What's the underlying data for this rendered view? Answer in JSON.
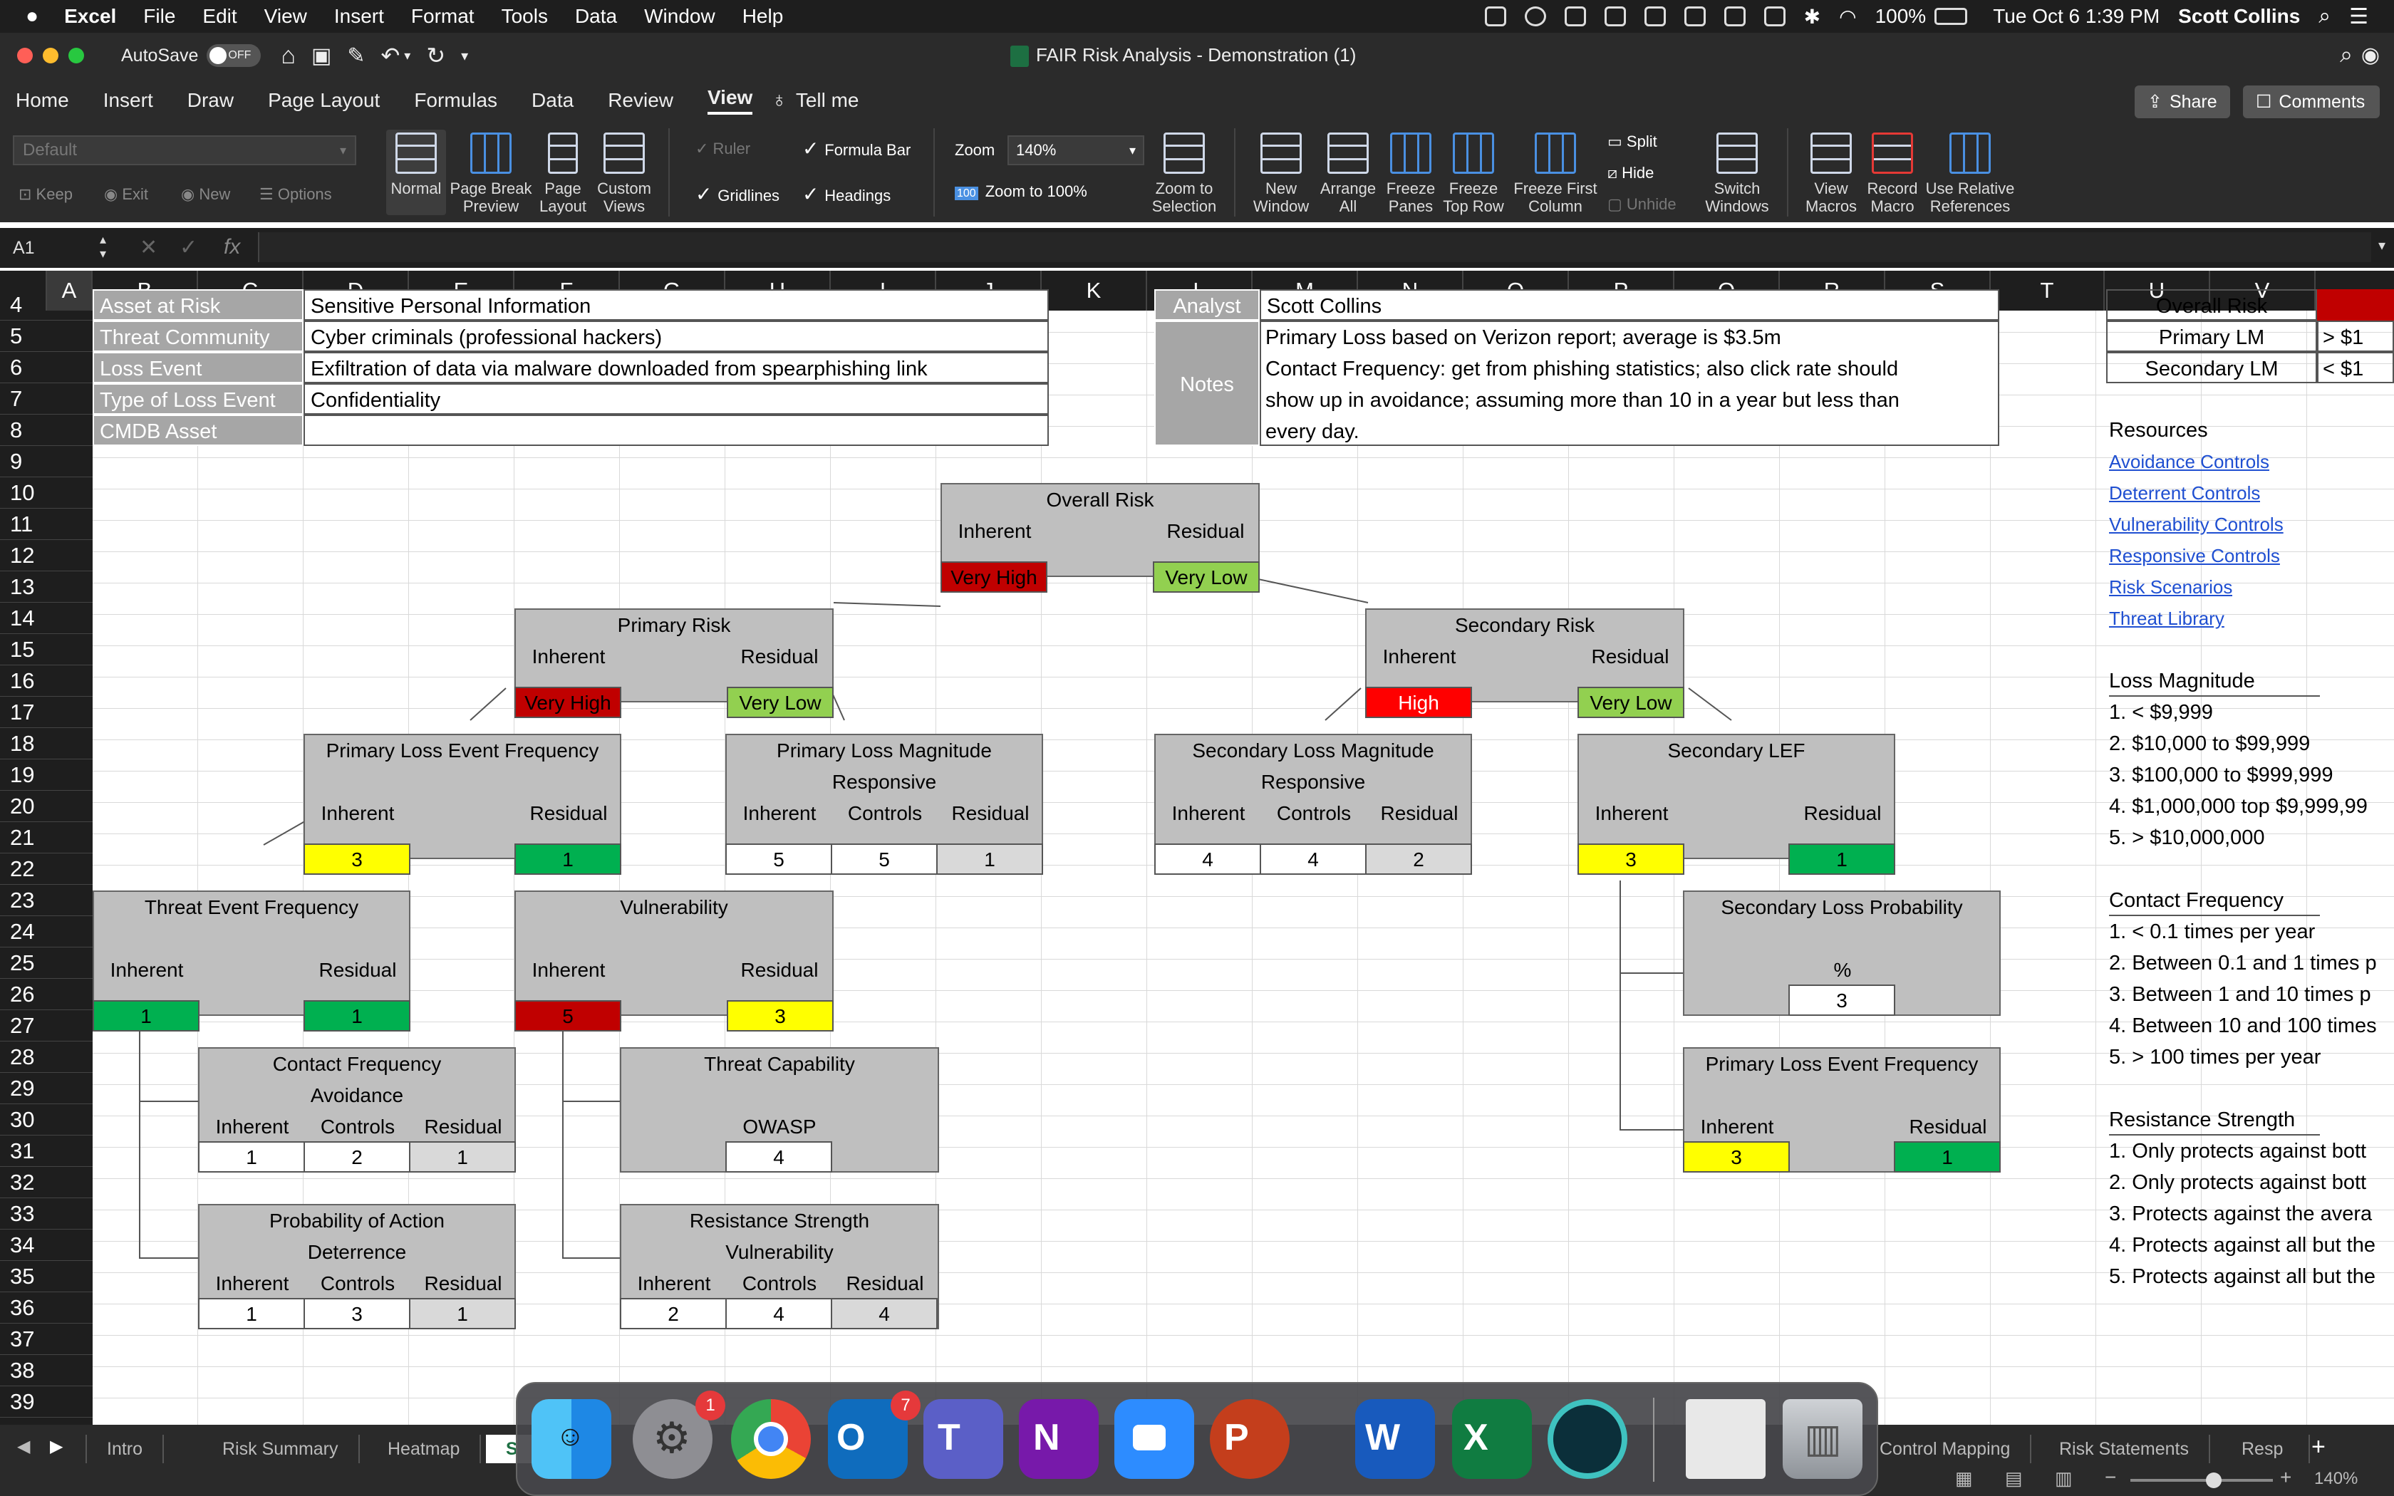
{
  "menubar": {
    "app": "Excel",
    "items": [
      "File",
      "Edit",
      "View",
      "Insert",
      "Format",
      "Tools",
      "Data",
      "Window",
      "Help"
    ],
    "battery": "100%",
    "datetime": "Tue Oct 6  1:39 PM",
    "user": "Scott Collins"
  },
  "titlebar": {
    "autosave_label": "AutoSave",
    "autosave_state": "OFF",
    "doc_title": "FAIR Risk Analysis - Demonstration (1)"
  },
  "ribbon_tabs": [
    "Home",
    "Insert",
    "Draw",
    "Page Layout",
    "Formulas",
    "Data",
    "Review",
    "View"
  ],
  "ribbon_active_tab": "View",
  "tell_me": "Tell me",
  "share_label": "Share",
  "comments_label": "Comments",
  "ribbon": {
    "sheet_view_select": "Default",
    "keep": "Keep",
    "exit": "Exit",
    "new": "New",
    "options": "Options",
    "normal": "Normal",
    "page_break_preview": [
      "Page Break",
      "Preview"
    ],
    "page_layout": [
      "Page",
      "Layout"
    ],
    "custom_views": [
      "Custom",
      "Views"
    ],
    "ruler": "Ruler",
    "formula_bar": "Formula Bar",
    "gridlines": "Gridlines",
    "headings": "Headings",
    "zoom_label": "Zoom",
    "zoom_value": "140%",
    "zoom_100_icon": "100",
    "zoom_to_100": "Zoom to 100%",
    "zoom_to_selection": [
      "Zoom to",
      "Selection"
    ],
    "new_window": [
      "New",
      "Window"
    ],
    "arrange_all": [
      "Arrange",
      "All"
    ],
    "freeze_panes": [
      "Freeze",
      "Panes"
    ],
    "freeze_top_row": [
      "Freeze",
      "Top Row"
    ],
    "freeze_first_column": [
      "Freeze First",
      "Column"
    ],
    "split": "Split",
    "hide": "Hide",
    "unhide": "Unhide",
    "switch_windows": [
      "Switch",
      "Windows"
    ],
    "view_macros": [
      "View",
      "Macros"
    ],
    "record_macro": [
      "Record",
      "Macro"
    ],
    "use_relative_references": [
      "Use Relative",
      "References"
    ]
  },
  "formula_bar": {
    "name_box": "A1",
    "fx": "fx",
    "content": ""
  },
  "columns": [
    "A",
    "B",
    "C",
    "D",
    "E",
    "F",
    "G",
    "H",
    "I",
    "J",
    "K",
    "L",
    "M",
    "N",
    "O",
    "P",
    "Q",
    "R",
    "S",
    "T",
    "U",
    "V"
  ],
  "rows": [
    "4",
    "5",
    "6",
    "7",
    "8",
    "9",
    "10",
    "11",
    "12",
    "13",
    "14",
    "15",
    "16",
    "17",
    "18",
    "19",
    "20",
    "21",
    "22",
    "23",
    "24",
    "25",
    "26",
    "27",
    "28",
    "29",
    "30",
    "31",
    "32",
    "33",
    "34",
    "35",
    "36",
    "37",
    "38",
    "39"
  ],
  "info_labels": [
    {
      "label": "Asset at Risk",
      "value": "Sensitive Personal Information"
    },
    {
      "label": "Threat Community",
      "value": "Cyber criminals (professional hackers)"
    },
    {
      "label": "Loss Event",
      "value": "Exfiltration of data via malware downloaded from spearphishing link"
    },
    {
      "label": "Type of Loss Event",
      "value": "Confidentiality"
    },
    {
      "label": "CMDB Asset",
      "value": ""
    }
  ],
  "analyst": {
    "label": "Analyst",
    "value": "Scott Collins"
  },
  "notes": {
    "label": "Notes",
    "lines": [
      "Primary Loss based on Verizon report; average is $3.5m",
      "Contact Frequency: get from phishing statistics; also click rate should",
      "show up in avoidance; assuming more than 10 in a year but less than",
      "every day."
    ]
  },
  "common": {
    "inherent": "Inherent",
    "residual": "Residual",
    "controls": "Controls"
  },
  "overall_risk": {
    "title": "Overall Risk",
    "inherent": "Very High",
    "residual": "Very Low"
  },
  "primary_risk": {
    "title": "Primary Risk",
    "inherent": "Very High",
    "residual": "Very Low"
  },
  "secondary_risk": {
    "title": "Secondary Risk",
    "inherent": "High",
    "residual": "Very Low"
  },
  "plef": {
    "title": "Primary Loss Event Frequency",
    "inherent": "3",
    "residual": "1"
  },
  "plm": {
    "title": "Primary Loss Magnitude",
    "subtitle": "Responsive",
    "inherent": "5",
    "controls": "5",
    "residual": "1"
  },
  "slm": {
    "title": "Secondary Loss Magnitude",
    "subtitle": "Responsive",
    "inherent": "4",
    "controls": "4",
    "residual": "2"
  },
  "slef": {
    "title": "Secondary LEF",
    "inherent": "3",
    "residual": "1"
  },
  "tef": {
    "title": "Threat Event Frequency",
    "inherent": "1",
    "residual": "1"
  },
  "vuln": {
    "title": "Vulnerability",
    "inherent": "5",
    "residual": "3"
  },
  "slp": {
    "title": "Secondary Loss Probability",
    "unit": "%",
    "value": "3"
  },
  "plef2": {
    "title": "Primary Loss Event Frequency",
    "inherent": "3",
    "residual": "1"
  },
  "cf": {
    "title": "Contact Frequency",
    "subtitle": "Avoidance",
    "inherent": "1",
    "controls": "2",
    "residual": "1"
  },
  "tc": {
    "title": "Threat Capability",
    "subtitle": "OWASP",
    "value": "4"
  },
  "poa": {
    "title": "Probability of Action",
    "subtitle": "Deterrence",
    "inherent": "1",
    "controls": "3",
    "residual": "1"
  },
  "rs": {
    "title": "Resistance Strength",
    "subtitle": "Vulnerability",
    "inherent": "2",
    "controls": "4",
    "residual": "4"
  },
  "right_panel": {
    "header_partial": "Overall Risk",
    "primary_lm": "Primary LM",
    "primary_lm_val": "> $1",
    "secondary_lm": "Secondary LM",
    "secondary_lm_val": "< $1",
    "resources_title": "Resources",
    "resources": [
      "Avoidance Controls",
      "Deterrent Controls",
      "Vulnerability Controls",
      "Responsive Controls",
      "Risk Scenarios",
      "Threat Library"
    ],
    "loss_magnitude_title": "Loss Magnitude",
    "loss_magnitude": [
      "1. < $9,999",
      "2. $10,000 to $99,999",
      "3. $100,000 to $999,999",
      "4. $1,000,000 top $9,999,99",
      "5. > $10,000,000"
    ],
    "contact_frequency_title": "Contact Frequency",
    "contact_frequency": [
      "1. < 0.1 times per year",
      "2. Between 0.1 and 1 times p",
      "3. Between 1 and 10 times p",
      "4. Between 10 and 100 times",
      "5. > 100 times per year"
    ],
    "resistance_strength_title": "Resistance Strength",
    "resistance_strength": [
      "1. Only protects against bott",
      "2. Only protects against bott",
      "3. Protects against the avera",
      "4. Protects against all but the",
      "5. Protects against all but the"
    ]
  },
  "sheet_tabs": [
    "Intro",
    "Risk Summary",
    "Heatmap",
    "S",
    "Control Mapping",
    "Risk Statements",
    "Resp"
  ],
  "statusbar": {
    "zoom": "140%"
  },
  "dock": {
    "apps": [
      "Finder",
      "System Preferences",
      "Chrome",
      "Outlook",
      "Teams",
      "OneNote",
      "Zoom",
      "PowerPoint",
      "Word",
      "Excel",
      "Webex",
      "Preview",
      "Trash"
    ],
    "badges": {
      "System Preferences": "1",
      "Outlook": "7"
    },
    "glyphs": {
      "Outlook": "O",
      "Teams": "T",
      "OneNote": "N",
      "PowerPoint": "P",
      "Word": "W",
      "Excel": "X"
    }
  },
  "colors": {
    "very_high": "#c00000",
    "high": "#ff0000",
    "very_low": "#92d050",
    "low": "#00b050",
    "medium": "#ffff00",
    "label_gray": "#a6a6a6",
    "box_gray": "#bfbfbf"
  }
}
